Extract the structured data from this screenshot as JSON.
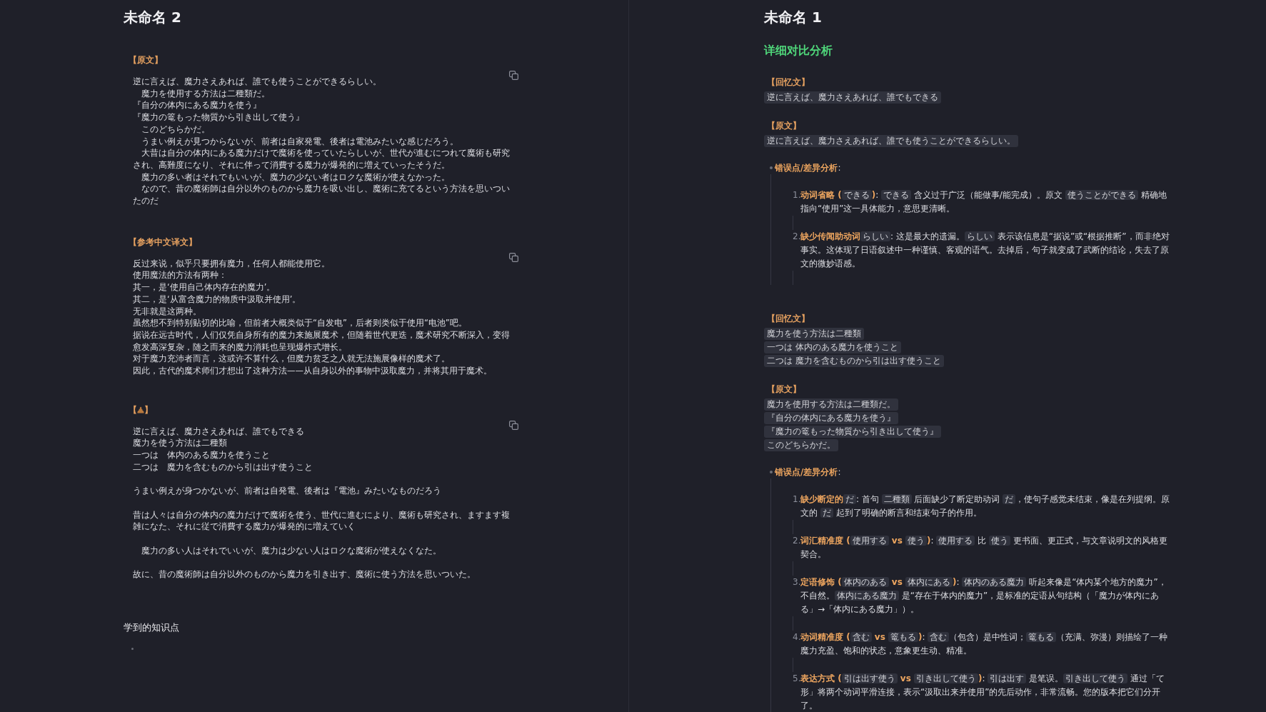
{
  "left": {
    "title": "未命名 2",
    "sections": [
      {
        "label": "【原文】",
        "groups": [
          [
            "逆に言えば、魔力さえあれば、誰でも使うことができるらしい。",
            "　魔力を使用する方法は二種類だ。",
            "『自分の体内にある魔力を使う』",
            "『魔力の篭もった物質から引き出して使う』",
            "　このどちらかだ。",
            "　うまい例えが見つからないが、前者は自家発電、後者は電池みたいな感じだろう。",
            "　大昔は自分の体内にある魔力だけで魔術を使っていたらしいが、世代が進むにつれて魔術も研究され、高難度になり、それに伴って消費する魔力が爆発的に増えていったそうだ。",
            "　魔力の多い者はそれでもいいが、魔力の少ない者はロクな魔術が使えなかった。",
            "　なので、昔の魔術師は自分以外のものから魔力を吸い出し、魔術に充てるという方法を思いついたのだ"
          ]
        ]
      },
      {
        "label": "【参考中文译文】",
        "groups": [
          [
            "反过来说，似乎只要拥有魔力，任何人都能使用它。",
            "使用魔法的方法有两种：",
            "其一，是‘使用自己体内存在的魔力’。",
            "其二，是‘从富含魔力的物质中汲取并使用’。",
            "无非就是这两种。",
            "虽然想不到特别贴切的比喻，但前者大概类似于“自发电”，后者则类似于使用“电池”吧。",
            "据说在远古时代，人们仅凭自身所有的魔力来施展魔术，但随着世代更迭，魔术研究不断深入，变得愈发高深复杂，随之而来的魔力消耗也呈现爆炸式增长。",
            "对于魔力充沛者而言，这或许不算什么，但魔力贫乏之人就无法施展像样的魔术了。",
            "因此，古代的魔术师们才想出了这种方法——从自身以外的事物中汲取魔力，并将其用于魔术。"
          ]
        ]
      },
      {
        "label_open": "【",
        "label_close": "】",
        "groups": [
          [
            "逆に言えば、魔力さえあれば、誰でもできる",
            "魔力を使う方法は二種類",
            "一つは　体内のある魔力を使うこと",
            "二つは　魔力を含むものから引は出す使うこと"
          ],
          [
            "うまい例えが身つかないが、前者は自発電、後者は『電池』みたいなものだろう"
          ],
          [
            "昔は人々は自分の体内の魔力だけで魔術を使う、世代に進むにより、魔術も研究され、ますます複雑になた、それに従で消費する魔力が爆発的に増えていく"
          ],
          [
            "　魔力の多い人はそれでいいが、魔力は少ない人はロクな魔術が使えなくなた。"
          ],
          [
            "故に、昔の魔術師は自分以外のものから魔力を引き出す、魔術に使う方法を思いついた。"
          ]
        ]
      }
    ],
    "notes_heading": "学到的知识点"
  },
  "right": {
    "title": "未命名 1",
    "heading": "详细对比分析",
    "blocks": [
      {
        "kind": "quote",
        "label": "【回忆文】",
        "lines": [
          "逆に言えば、魔力さえあれば、誰でもできる"
        ]
      },
      {
        "kind": "quote",
        "label": "【原文】",
        "lines": [
          "逆に言えば、魔力さえあれば、誰でも使うことができるらしい。"
        ]
      },
      {
        "kind": "analysis",
        "heading": [
          {
            "kind": "b",
            "text": "错误点/差异分析"
          },
          {
            "kind": "t",
            "text": ":"
          }
        ],
        "items": [
          {
            "number": "1.",
            "parts": [
              {
                "kind": "b",
                "text": "动词省略 ("
              },
              {
                "kind": "c",
                "text": "できる"
              },
              {
                "kind": "b",
                "text": ")"
              },
              {
                "kind": "t",
                "text": ": "
              },
              {
                "kind": "c",
                "text": "できる"
              },
              {
                "kind": "t",
                "text": " 含义过于广泛（能做事/能完成）。原文 "
              },
              {
                "kind": "c",
                "text": "使うことができる"
              },
              {
                "kind": "t",
                "text": " 精确地指向“使用”这一具体能力，意思更清晰。"
              }
            ]
          },
          {
            "number": "2.",
            "parts": [
              {
                "kind": "b",
                "text": "缺少传闻助动词"
              },
              {
                "kind": "c",
                "text": "らしい"
              },
              {
                "kind": "t",
                "text": ": 这是最大的遗漏。"
              },
              {
                "kind": "c",
                "text": "らしい"
              },
              {
                "kind": "t",
                "text": " 表示该信息是“据说”或“根据推断”，而非绝对事实。这体现了日语叙述中一种谨慎、客观的语气。去掉后，句子就变成了武断的结论，失去了原文的微妙语感。"
              }
            ]
          }
        ]
      },
      {
        "kind": "quote",
        "label": "【回忆文】",
        "lines": [
          "魔力を使う方法は二種類",
          "一つは 体内のある魔力を使うこと",
          "二つは 魔力を含むものから引は出す使うこと"
        ]
      },
      {
        "kind": "quote",
        "label": "【原文】",
        "lines": [
          "魔力を使用する方法は二種類だ。",
          "『自分の体内にある魔力を使う』",
          "『魔力の篭もった物質から引き出して使う』",
          "このどちらかだ。"
        ]
      },
      {
        "kind": "analysis",
        "heading": [
          {
            "kind": "b",
            "text": "错误点/差异分析"
          },
          {
            "kind": "t",
            "text": ":"
          }
        ],
        "items": [
          {
            "number": "1.",
            "parts": [
              {
                "kind": "b",
                "text": "缺少断定的"
              },
              {
                "kind": "c",
                "text": "だ"
              },
              {
                "kind": "t",
                "text": ": 首句 "
              },
              {
                "kind": "c",
                "text": "二種類"
              },
              {
                "kind": "t",
                "text": " 后面缺少了断定助动词 "
              },
              {
                "kind": "c",
                "text": "だ"
              },
              {
                "kind": "t",
                "text": "，使句子感觉未结束，像是在列提纲。原文的 "
              },
              {
                "kind": "c",
                "text": "だ"
              },
              {
                "kind": "t",
                "text": " 起到了明确的断言和结束句子的作用。"
              }
            ]
          },
          {
            "number": "2.",
            "parts": [
              {
                "kind": "b",
                "text": "词汇精准度 ("
              },
              {
                "kind": "c",
                "text": "使用する"
              },
              {
                "kind": "b",
                "text": " vs "
              },
              {
                "kind": "c",
                "text": "使う"
              },
              {
                "kind": "b",
                "text": ")"
              },
              {
                "kind": "t",
                "text": ": "
              },
              {
                "kind": "c",
                "text": "使用する"
              },
              {
                "kind": "t",
                "text": " 比 "
              },
              {
                "kind": "c",
                "text": "使う"
              },
              {
                "kind": "t",
                "text": " 更书面、更正式，与文章说明文的风格更契合。"
              }
            ]
          },
          {
            "number": "3.",
            "parts": [
              {
                "kind": "b",
                "text": "定语修饰 ("
              },
              {
                "kind": "c",
                "text": "体内のある"
              },
              {
                "kind": "b",
                "text": " vs "
              },
              {
                "kind": "c",
                "text": "体内にある"
              },
              {
                "kind": "b",
                "text": ")"
              },
              {
                "kind": "t",
                "text": ": "
              },
              {
                "kind": "c",
                "text": "体内のある魔力"
              },
              {
                "kind": "t",
                "text": " 听起来像是“体内某个地方的魔力”，不自然。"
              },
              {
                "kind": "c",
                "text": "体内にある魔力"
              },
              {
                "kind": "t",
                "text": " 是“存在于体内的魔力”，是标准的定语从句结构（「魔力が体内にある」→「体内にある魔力」）。"
              }
            ]
          },
          {
            "number": "4.",
            "parts": [
              {
                "kind": "b",
                "text": "动词精准度 ("
              },
              {
                "kind": "c",
                "text": "含む"
              },
              {
                "kind": "b",
                "text": " vs "
              },
              {
                "kind": "c",
                "text": "篭もる"
              },
              {
                "kind": "b",
                "text": ")"
              },
              {
                "kind": "t",
                "text": ": "
              },
              {
                "kind": "c",
                "text": "含む"
              },
              {
                "kind": "t",
                "text": "（包含）是中性词；"
              },
              {
                "kind": "c",
                "text": "篭もる"
              },
              {
                "kind": "t",
                "text": "（充满、弥漫）则描绘了一种魔力充盈、饱和的状态，意象更生动、精准。"
              }
            ]
          },
          {
            "number": "5.",
            "parts": [
              {
                "kind": "b",
                "text": "表达方式 ("
              },
              {
                "kind": "c",
                "text": "引は出す使う"
              },
              {
                "kind": "b",
                "text": " vs "
              },
              {
                "kind": "c",
                "text": "引き出して使う"
              },
              {
                "kind": "b",
                "text": ")"
              },
              {
                "kind": "t",
                "text": ": "
              },
              {
                "kind": "c",
                "text": "引は出す"
              },
              {
                "kind": "t",
                "text": " 是笔误。"
              },
              {
                "kind": "c",
                "text": "引き出して使う"
              },
              {
                "kind": "t",
                "text": " 通过「て形」将两个动词平滑连接，表示“汲取出来并使用”的先后动作，非常流畅。您的版本把它们分开了。"
              }
            ]
          }
        ]
      }
    ]
  }
}
